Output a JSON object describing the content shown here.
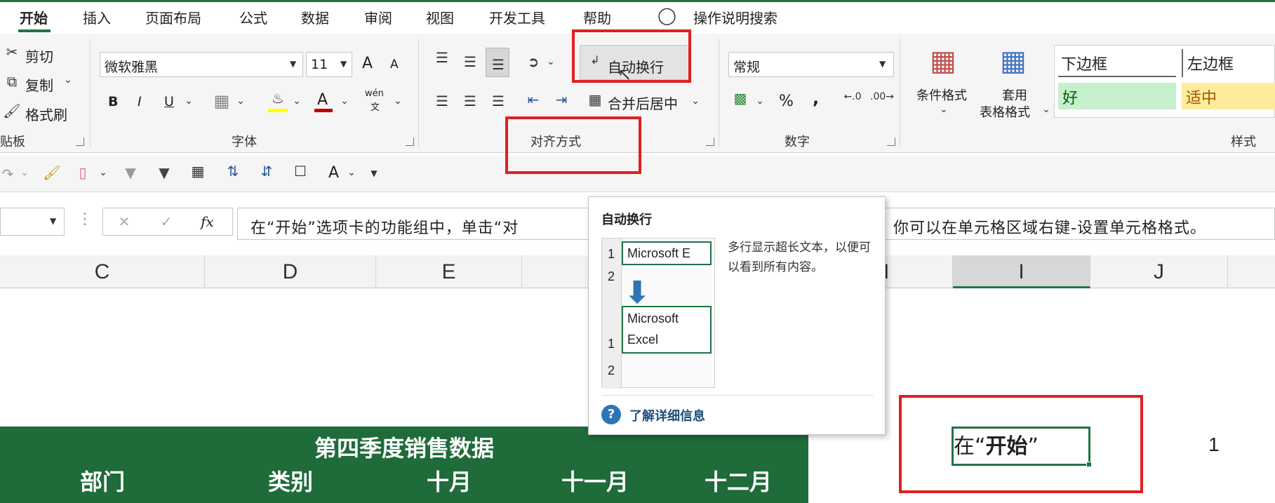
{
  "tabs": [
    {
      "label": "开始",
      "active": true
    },
    {
      "label": "插入"
    },
    {
      "label": "页面布局"
    },
    {
      "label": "公式"
    },
    {
      "label": "数据"
    },
    {
      "label": "审阅"
    },
    {
      "label": "视图"
    },
    {
      "label": "开发工具"
    },
    {
      "label": "帮助"
    }
  ],
  "tell_me": "操作说明搜索",
  "clipboard": {
    "cut": "剪切",
    "copy": "复制",
    "format_painter": "格式刷",
    "group": "贴板"
  },
  "font": {
    "name": "微软雅黑",
    "size": "11",
    "grow": "A",
    "shrink": "A",
    "bold": "B",
    "italic": "I",
    "underline": "U",
    "font_color_glyph": "A",
    "phonetic_top": "wén",
    "phonetic_bottom": "文",
    "group": "字体"
  },
  "alignment": {
    "wrap_text": "自动换行",
    "merge_center": "合并后居中",
    "group": "对齐方式"
  },
  "number": {
    "format": "常规",
    "percent": "%",
    "comma": ",",
    "group": "数字"
  },
  "styles": {
    "conditional_line1": "条件格式",
    "table_line1": "套用",
    "table_line2": "表格格式",
    "group": "样式",
    "cells": [
      {
        "label": "下边框",
        "bg": "#ffffff"
      },
      {
        "label": "左边框",
        "bg": "#ffffff"
      },
      {
        "label": "好",
        "bg": "#c6efce",
        "color": "#006100"
      },
      {
        "label": "适中",
        "bg": "#ffeb9c",
        "color": "#9c5700"
      }
    ]
  },
  "qat": {
    "font_color_glyph": "A"
  },
  "formula_bar": {
    "fx": "fx",
    "content": "在“开始”选项卡的功能组中，单击“对",
    "content_right": "你可以在单元格区域右键-设置单元格格式。"
  },
  "tooltip": {
    "title": "自动换行",
    "row1": "1",
    "row2": "2",
    "before_text": "Microsoft E",
    "after_line1": "Microsoft",
    "after_line2": "Excel",
    "description": "多行显示超长文本，以便可以看到所有内容。",
    "more_info": "了解详细信息"
  },
  "columns": [
    "C",
    "D",
    "E",
    "H",
    "I",
    "J"
  ],
  "sheet": {
    "title": "第四季度销售数据",
    "headers": [
      "部门",
      "类别",
      "十月",
      "十一月",
      "十二月"
    ],
    "cell_text_prefix": "在“",
    "cell_text_bold": "开始",
    "cell_text_suffix": "”",
    "cell_value": "1"
  },
  "colors": {
    "accent_green": "#217346",
    "table_green": "#1f6b3a",
    "highlight_red": "#e02020"
  }
}
